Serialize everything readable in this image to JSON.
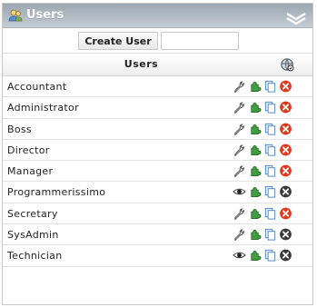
{
  "panel": {
    "title": "Users",
    "title_icon": "users-icon",
    "collapse_icon": "double-chevron-up-icon"
  },
  "create": {
    "button_label": "Create User",
    "input_value": "",
    "input_placeholder": ""
  },
  "table": {
    "header": "Users",
    "header_icon": "settings-globe-icon",
    "rows": [
      {
        "name": "Accountant",
        "edit_icon": "wrench-icon"
      },
      {
        "name": "Administrator",
        "edit_icon": "wrench-icon"
      },
      {
        "name": "Boss",
        "edit_icon": "wrench-icon"
      },
      {
        "name": "Director",
        "edit_icon": "wrench-icon"
      },
      {
        "name": "Manager",
        "edit_icon": "wrench-icon"
      },
      {
        "name": "Programmerissimo",
        "edit_icon": "eye-icon"
      },
      {
        "name": "Secretary",
        "edit_icon": "wrench-icon"
      },
      {
        "name": "SysAdmin",
        "edit_icon": "wrench-icon"
      },
      {
        "name": "Technician",
        "edit_icon": "eye-icon"
      }
    ],
    "row_icons": [
      "edit",
      "puzzle-icon",
      "copy-icon",
      "delete-icon"
    ]
  },
  "colors": {
    "titlebar": "#a9b3be",
    "delete_active": "#e03a1e",
    "delete_disabled": "#3a3a3a",
    "puzzle_green": "#3f9e3f",
    "copy_blue": "#4a86c8"
  }
}
